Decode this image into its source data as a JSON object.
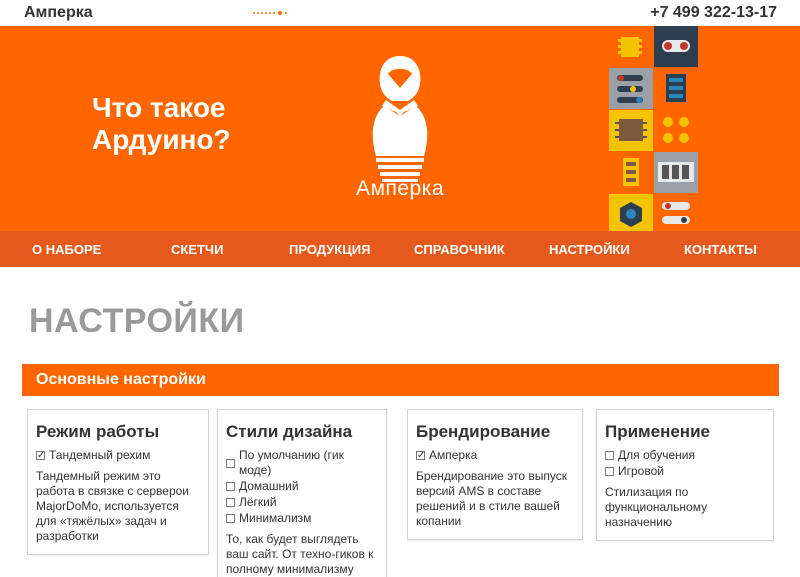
{
  "header": {
    "brand": "Амперка",
    "phone": "+7 499 322-13-17"
  },
  "hero": {
    "title": "Что такое Ардуино?",
    "logo_text": "Амперка",
    "colors": {
      "background": "#ff6600",
      "text": "#ffffff"
    }
  },
  "nav": {
    "items": [
      {
        "label": "О НАБОРЕ"
      },
      {
        "label": "СКЕТЧИ"
      },
      {
        "label": "ПРОДУКЦИЯ"
      },
      {
        "label": "СПРАВОЧНИК"
      },
      {
        "label": "НАСТРОЙКИ"
      },
      {
        "label": "КОНТАКТЫ"
      }
    ]
  },
  "page": {
    "title": "НАСТРОЙКИ",
    "section_title": "Основные настройки"
  },
  "cards": [
    {
      "title": "Режим работы",
      "options": [
        {
          "label": "Тандемный рехим",
          "checked": true
        }
      ],
      "description": "Тандемный режим это работа в связке с серверои MajorDoMo, используется для «тяжёлых» задач и разработки"
    },
    {
      "title": "Стили дизайна",
      "options": [
        {
          "label": "По умолчанию (гик моде)",
          "checked": false
        },
        {
          "label": "Домашний",
          "checked": false
        },
        {
          "label": "Лёгкий",
          "checked": false
        },
        {
          "label": "Минимализм",
          "checked": false
        }
      ],
      "description": "То, как будет выглядеть ваш сайт. От техно-гиков к полному минимализму"
    },
    {
      "title": "Брендирование",
      "options": [
        {
          "label": "Амперка",
          "checked": true
        }
      ],
      "description": "Брендирование это выпуск версий AMS в составе решений и в стиле вашей копании"
    },
    {
      "title": "Применение",
      "options": [
        {
          "label": "Для обучения",
          "checked": false
        },
        {
          "label": "Игровой",
          "checked": false
        }
      ],
      "description": "Стилизация по функциональному назначению"
    }
  ],
  "colors": {
    "accent": "#ff6600",
    "nav": "#e55a1c",
    "title_gray": "#9a9a9a"
  }
}
